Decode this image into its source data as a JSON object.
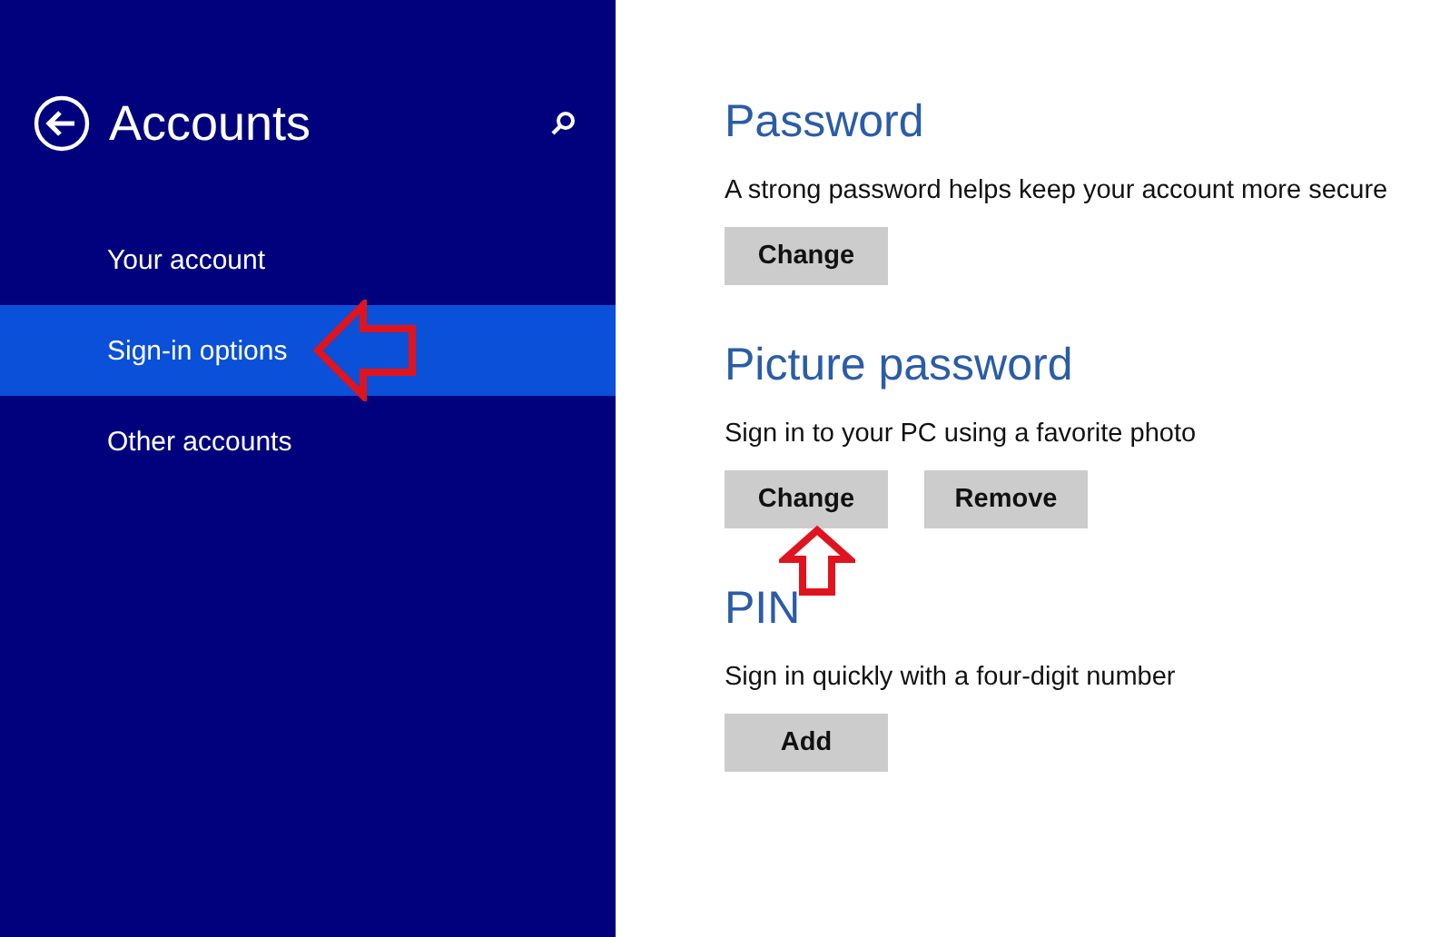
{
  "sidebar": {
    "title": "Accounts",
    "items": [
      {
        "label": "Your account",
        "selected": false,
        "pointer_arrow": false
      },
      {
        "label": "Sign-in options",
        "selected": true,
        "pointer_arrow": true
      },
      {
        "label": "Other accounts",
        "selected": false,
        "pointer_arrow": false
      }
    ]
  },
  "sections": [
    {
      "heading": "Password",
      "description": "A strong password helps keep your account more secure",
      "buttons": [
        {
          "label": "Change",
          "pointer_arrow": false
        }
      ]
    },
    {
      "heading": "Picture password",
      "description": "Sign in to your PC using a favorite photo",
      "buttons": [
        {
          "label": "Change",
          "pointer_arrow": true
        },
        {
          "label": "Remove",
          "pointer_arrow": false
        }
      ]
    },
    {
      "heading": "PIN",
      "description": "Sign in quickly with a four-digit number",
      "buttons": [
        {
          "label": "Add",
          "pointer_arrow": false
        }
      ]
    }
  ]
}
